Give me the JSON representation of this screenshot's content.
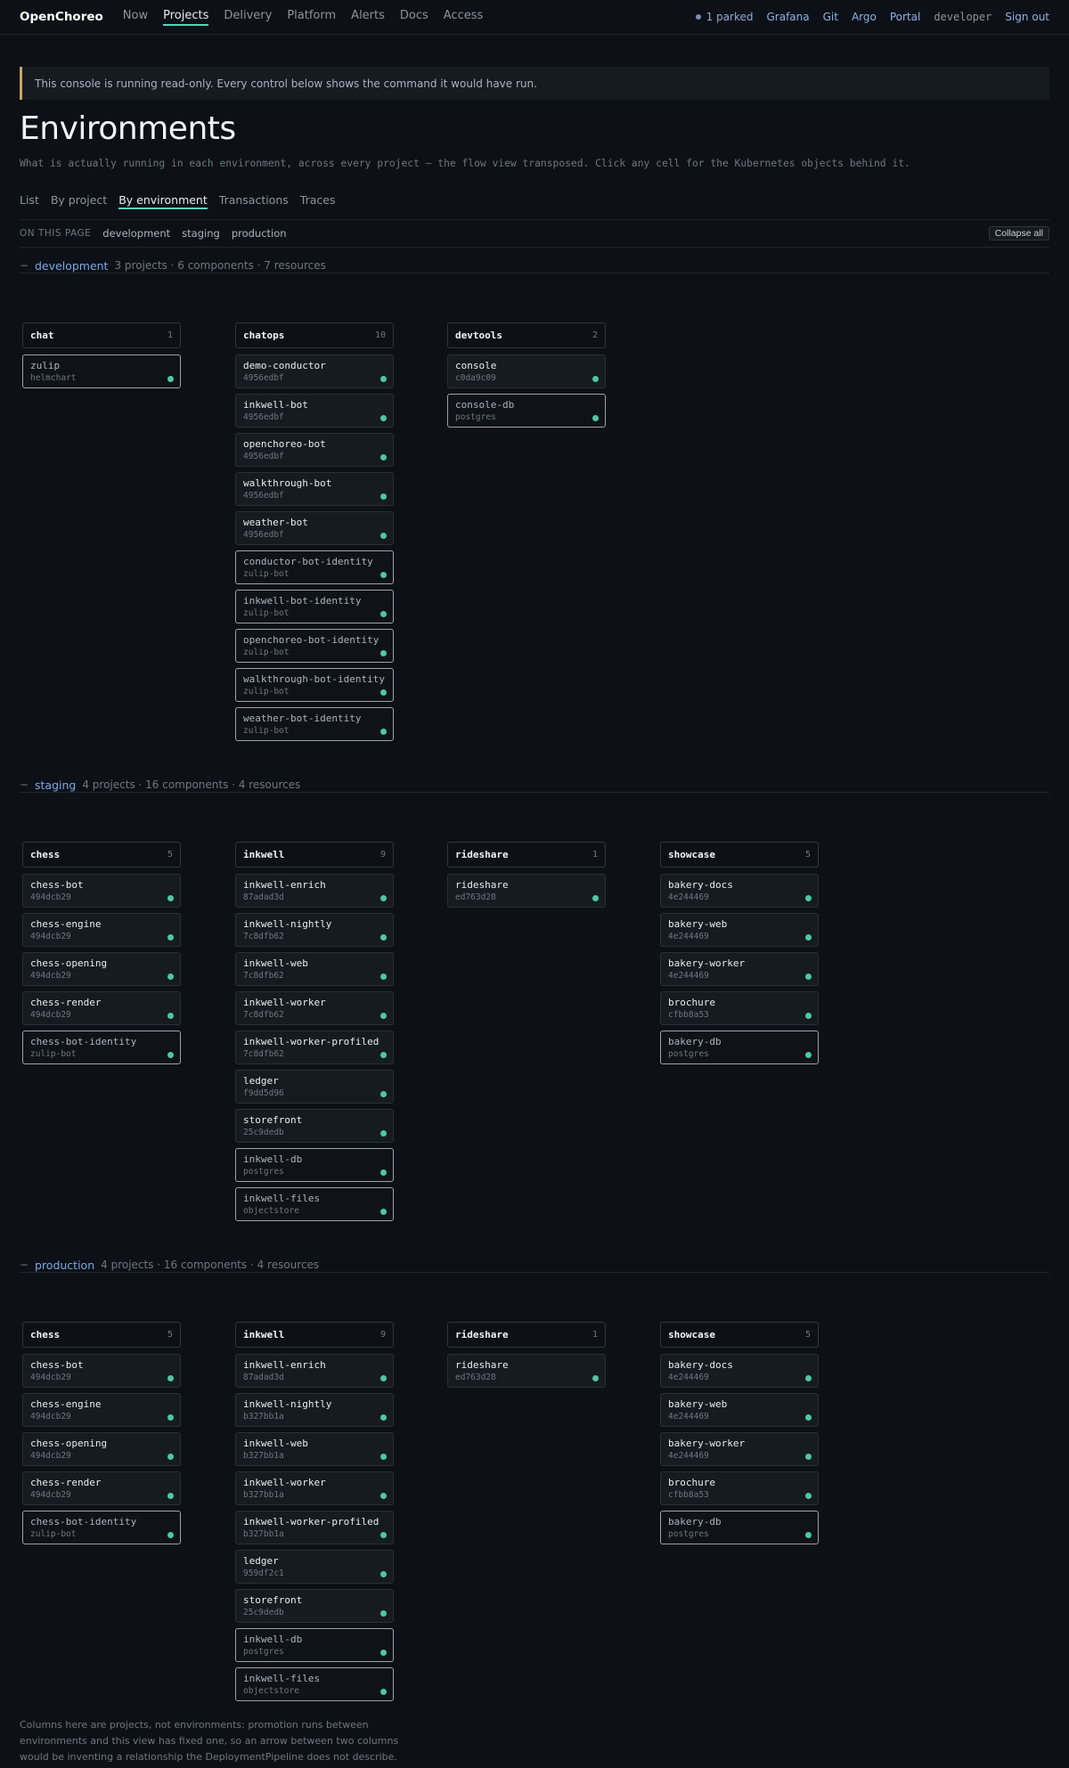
{
  "nav": {
    "brand": "OpenChoreo",
    "items": [
      "Now",
      "Projects",
      "Delivery",
      "Platform",
      "Alerts",
      "Docs",
      "Access"
    ],
    "active": "Projects",
    "parked": "1 parked",
    "links": [
      "Grafana",
      "Git",
      "Argo",
      "Portal"
    ],
    "user": "developer",
    "signout": "Sign out"
  },
  "notice": "This console is running read-only. Every control below shows the command it would have run.",
  "page": {
    "title": "Environments",
    "subtitle": "What is actually running in each environment, across every project — the flow view transposed. Click any cell for the Kubernetes objects behind it."
  },
  "tabs": [
    "List",
    "By project",
    "By environment",
    "Transactions",
    "Traces"
  ],
  "active_tab": "By environment",
  "onpage": {
    "label": "ON THIS PAGE",
    "links": [
      "development",
      "staging",
      "production"
    ],
    "collapse": "Collapse all"
  },
  "toggle_glyph": "−",
  "environments": [
    {
      "name": "development",
      "meta": "3 projects · 6 components · 7 resources",
      "projects": [
        {
          "name": "chat",
          "count": "1",
          "cards": [
            {
              "name": "zulip",
              "sub": "helmchart",
              "kind": "resource"
            }
          ]
        },
        {
          "name": "chatops",
          "count": "10",
          "cards": [
            {
              "name": "demo-conductor",
              "sub": "4956edbf",
              "kind": "component"
            },
            {
              "name": "inkwell-bot",
              "sub": "4956edbf",
              "kind": "component"
            },
            {
              "name": "openchoreo-bot",
              "sub": "4956edbf",
              "kind": "component"
            },
            {
              "name": "walkthrough-bot",
              "sub": "4956edbf",
              "kind": "component"
            },
            {
              "name": "weather-bot",
              "sub": "4956edbf",
              "kind": "component"
            },
            {
              "name": "conductor-bot-identity",
              "sub": "zulip-bot",
              "kind": "resource"
            },
            {
              "name": "inkwell-bot-identity",
              "sub": "zulip-bot",
              "kind": "resource"
            },
            {
              "name": "openchoreo-bot-identity",
              "sub": "zulip-bot",
              "kind": "resource"
            },
            {
              "name": "walkthrough-bot-identity",
              "sub": "zulip-bot",
              "kind": "resource"
            },
            {
              "name": "weather-bot-identity",
              "sub": "zulip-bot",
              "kind": "resource"
            }
          ]
        },
        {
          "name": "devtools",
          "count": "2",
          "cards": [
            {
              "name": "console",
              "sub": "c0da9c09",
              "kind": "component"
            },
            {
              "name": "console-db",
              "sub": "postgres",
              "kind": "resource"
            }
          ]
        }
      ]
    },
    {
      "name": "staging",
      "meta": "4 projects · 16 components · 4 resources",
      "projects": [
        {
          "name": "chess",
          "count": "5",
          "cards": [
            {
              "name": "chess-bot",
              "sub": "494dcb29",
              "kind": "component"
            },
            {
              "name": "chess-engine",
              "sub": "494dcb29",
              "kind": "component"
            },
            {
              "name": "chess-opening",
              "sub": "494dcb29",
              "kind": "component"
            },
            {
              "name": "chess-render",
              "sub": "494dcb29",
              "kind": "component"
            },
            {
              "name": "chess-bot-identity",
              "sub": "zulip-bot",
              "kind": "resource"
            }
          ]
        },
        {
          "name": "inkwell",
          "count": "9",
          "cards": [
            {
              "name": "inkwell-enrich",
              "sub": "87adad3d",
              "kind": "component"
            },
            {
              "name": "inkwell-nightly",
              "sub": "7c8dfb62",
              "kind": "component"
            },
            {
              "name": "inkwell-web",
              "sub": "7c8dfb62",
              "kind": "component"
            },
            {
              "name": "inkwell-worker",
              "sub": "7c8dfb62",
              "kind": "component"
            },
            {
              "name": "inkwell-worker-profiled",
              "sub": "7c8dfb62",
              "kind": "component"
            },
            {
              "name": "ledger",
              "sub": "f9dd5d96",
              "kind": "component"
            },
            {
              "name": "storefront",
              "sub": "25c9dedb",
              "kind": "component"
            },
            {
              "name": "inkwell-db",
              "sub": "postgres",
              "kind": "resource"
            },
            {
              "name": "inkwell-files",
              "sub": "objectstore",
              "kind": "resource"
            }
          ]
        },
        {
          "name": "rideshare",
          "count": "1",
          "cards": [
            {
              "name": "rideshare",
              "sub": "ed763d28",
              "kind": "component"
            }
          ]
        },
        {
          "name": "showcase",
          "count": "5",
          "cards": [
            {
              "name": "bakery-docs",
              "sub": "4e244469",
              "kind": "component"
            },
            {
              "name": "bakery-web",
              "sub": "4e244469",
              "kind": "component"
            },
            {
              "name": "bakery-worker",
              "sub": "4e244469",
              "kind": "component"
            },
            {
              "name": "brochure",
              "sub": "cfbb8a53",
              "kind": "component"
            },
            {
              "name": "bakery-db",
              "sub": "postgres",
              "kind": "resource"
            }
          ]
        }
      ]
    },
    {
      "name": "production",
      "meta": "4 projects · 16 components · 4 resources",
      "projects": [
        {
          "name": "chess",
          "count": "5",
          "cards": [
            {
              "name": "chess-bot",
              "sub": "494dcb29",
              "kind": "component"
            },
            {
              "name": "chess-engine",
              "sub": "494dcb29",
              "kind": "component"
            },
            {
              "name": "chess-opening",
              "sub": "494dcb29",
              "kind": "component"
            },
            {
              "name": "chess-render",
              "sub": "494dcb29",
              "kind": "component"
            },
            {
              "name": "chess-bot-identity",
              "sub": "zulip-bot",
              "kind": "resource"
            }
          ]
        },
        {
          "name": "inkwell",
          "count": "9",
          "cards": [
            {
              "name": "inkwell-enrich",
              "sub": "87adad3d",
              "kind": "component"
            },
            {
              "name": "inkwell-nightly",
              "sub": "b327bb1a",
              "kind": "component"
            },
            {
              "name": "inkwell-web",
              "sub": "b327bb1a",
              "kind": "component"
            },
            {
              "name": "inkwell-worker",
              "sub": "b327bb1a",
              "kind": "component"
            },
            {
              "name": "inkwell-worker-profiled",
              "sub": "b327bb1a",
              "kind": "component"
            },
            {
              "name": "ledger",
              "sub": "959df2c1",
              "kind": "component"
            },
            {
              "name": "storefront",
              "sub": "25c9dedb",
              "kind": "component"
            },
            {
              "name": "inkwell-db",
              "sub": "postgres",
              "kind": "resource"
            },
            {
              "name": "inkwell-files",
              "sub": "objectstore",
              "kind": "resource"
            }
          ]
        },
        {
          "name": "rideshare",
          "count": "1",
          "cards": [
            {
              "name": "rideshare",
              "sub": "ed763d28",
              "kind": "component"
            }
          ]
        },
        {
          "name": "showcase",
          "count": "5",
          "cards": [
            {
              "name": "bakery-docs",
              "sub": "4e244469",
              "kind": "component"
            },
            {
              "name": "bakery-web",
              "sub": "4e244469",
              "kind": "component"
            },
            {
              "name": "bakery-worker",
              "sub": "4e244469",
              "kind": "component"
            },
            {
              "name": "brochure",
              "sub": "cfbb8a53",
              "kind": "component"
            },
            {
              "name": "bakery-db",
              "sub": "postgres",
              "kind": "resource"
            }
          ]
        }
      ]
    }
  ],
  "footer": "Columns here are projects, not environments: promotion runs between environments and this view has fixed one, so an arrow between two columns would be inventing a relationship the DeploymentPipeline does not describe.",
  "colors": {
    "accent": "#56d4bc",
    "status_ok": "#4fc6a6",
    "link": "#79a8e6",
    "notice_bar": "#c9a463"
  }
}
